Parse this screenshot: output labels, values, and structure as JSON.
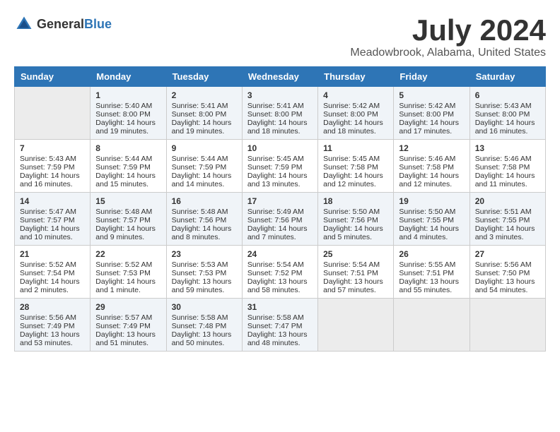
{
  "logo": {
    "text_general": "General",
    "text_blue": "Blue"
  },
  "title": {
    "month_year": "July 2024",
    "location": "Meadowbrook, Alabama, United States"
  },
  "weekdays": [
    "Sunday",
    "Monday",
    "Tuesday",
    "Wednesday",
    "Thursday",
    "Friday",
    "Saturday"
  ],
  "weeks": [
    [
      {
        "day": "",
        "content": ""
      },
      {
        "day": "1",
        "content": "Sunrise: 5:40 AM\nSunset: 8:00 PM\nDaylight: 14 hours\nand 19 minutes."
      },
      {
        "day": "2",
        "content": "Sunrise: 5:41 AM\nSunset: 8:00 PM\nDaylight: 14 hours\nand 19 minutes."
      },
      {
        "day": "3",
        "content": "Sunrise: 5:41 AM\nSunset: 8:00 PM\nDaylight: 14 hours\nand 18 minutes."
      },
      {
        "day": "4",
        "content": "Sunrise: 5:42 AM\nSunset: 8:00 PM\nDaylight: 14 hours\nand 18 minutes."
      },
      {
        "day": "5",
        "content": "Sunrise: 5:42 AM\nSunset: 8:00 PM\nDaylight: 14 hours\nand 17 minutes."
      },
      {
        "day": "6",
        "content": "Sunrise: 5:43 AM\nSunset: 8:00 PM\nDaylight: 14 hours\nand 16 minutes."
      }
    ],
    [
      {
        "day": "7",
        "content": "Sunrise: 5:43 AM\nSunset: 7:59 PM\nDaylight: 14 hours\nand 16 minutes."
      },
      {
        "day": "8",
        "content": "Sunrise: 5:44 AM\nSunset: 7:59 PM\nDaylight: 14 hours\nand 15 minutes."
      },
      {
        "day": "9",
        "content": "Sunrise: 5:44 AM\nSunset: 7:59 PM\nDaylight: 14 hours\nand 14 minutes."
      },
      {
        "day": "10",
        "content": "Sunrise: 5:45 AM\nSunset: 7:59 PM\nDaylight: 14 hours\nand 13 minutes."
      },
      {
        "day": "11",
        "content": "Sunrise: 5:45 AM\nSunset: 7:58 PM\nDaylight: 14 hours\nand 12 minutes."
      },
      {
        "day": "12",
        "content": "Sunrise: 5:46 AM\nSunset: 7:58 PM\nDaylight: 14 hours\nand 12 minutes."
      },
      {
        "day": "13",
        "content": "Sunrise: 5:46 AM\nSunset: 7:58 PM\nDaylight: 14 hours\nand 11 minutes."
      }
    ],
    [
      {
        "day": "14",
        "content": "Sunrise: 5:47 AM\nSunset: 7:57 PM\nDaylight: 14 hours\nand 10 minutes."
      },
      {
        "day": "15",
        "content": "Sunrise: 5:48 AM\nSunset: 7:57 PM\nDaylight: 14 hours\nand 9 minutes."
      },
      {
        "day": "16",
        "content": "Sunrise: 5:48 AM\nSunset: 7:56 PM\nDaylight: 14 hours\nand 8 minutes."
      },
      {
        "day": "17",
        "content": "Sunrise: 5:49 AM\nSunset: 7:56 PM\nDaylight: 14 hours\nand 7 minutes."
      },
      {
        "day": "18",
        "content": "Sunrise: 5:50 AM\nSunset: 7:56 PM\nDaylight: 14 hours\nand 5 minutes."
      },
      {
        "day": "19",
        "content": "Sunrise: 5:50 AM\nSunset: 7:55 PM\nDaylight: 14 hours\nand 4 minutes."
      },
      {
        "day": "20",
        "content": "Sunrise: 5:51 AM\nSunset: 7:55 PM\nDaylight: 14 hours\nand 3 minutes."
      }
    ],
    [
      {
        "day": "21",
        "content": "Sunrise: 5:52 AM\nSunset: 7:54 PM\nDaylight: 14 hours\nand 2 minutes."
      },
      {
        "day": "22",
        "content": "Sunrise: 5:52 AM\nSunset: 7:53 PM\nDaylight: 14 hours\nand 1 minute."
      },
      {
        "day": "23",
        "content": "Sunrise: 5:53 AM\nSunset: 7:53 PM\nDaylight: 13 hours\nand 59 minutes."
      },
      {
        "day": "24",
        "content": "Sunrise: 5:54 AM\nSunset: 7:52 PM\nDaylight: 13 hours\nand 58 minutes."
      },
      {
        "day": "25",
        "content": "Sunrise: 5:54 AM\nSunset: 7:51 PM\nDaylight: 13 hours\nand 57 minutes."
      },
      {
        "day": "26",
        "content": "Sunrise: 5:55 AM\nSunset: 7:51 PM\nDaylight: 13 hours\nand 55 minutes."
      },
      {
        "day": "27",
        "content": "Sunrise: 5:56 AM\nSunset: 7:50 PM\nDaylight: 13 hours\nand 54 minutes."
      }
    ],
    [
      {
        "day": "28",
        "content": "Sunrise: 5:56 AM\nSunset: 7:49 PM\nDaylight: 13 hours\nand 53 minutes."
      },
      {
        "day": "29",
        "content": "Sunrise: 5:57 AM\nSunset: 7:49 PM\nDaylight: 13 hours\nand 51 minutes."
      },
      {
        "day": "30",
        "content": "Sunrise: 5:58 AM\nSunset: 7:48 PM\nDaylight: 13 hours\nand 50 minutes."
      },
      {
        "day": "31",
        "content": "Sunrise: 5:58 AM\nSunset: 7:47 PM\nDaylight: 13 hours\nand 48 minutes."
      },
      {
        "day": "",
        "content": ""
      },
      {
        "day": "",
        "content": ""
      },
      {
        "day": "",
        "content": ""
      }
    ]
  ]
}
